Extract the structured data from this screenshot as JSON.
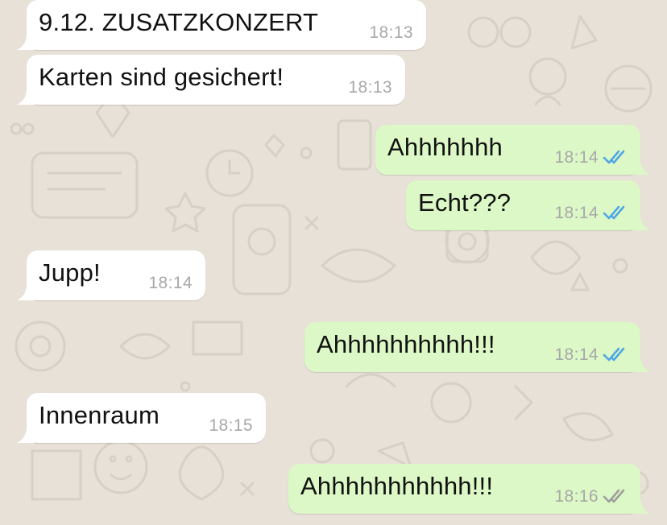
{
  "chat": {
    "messages": [
      {
        "direction": "in",
        "text": "9.12. ZUSATZKONZERT",
        "time": "18:13"
      },
      {
        "direction": "in",
        "text": "Karten sind gesichert!",
        "time": "18:13"
      },
      {
        "direction": "out",
        "text": "Ahhhhhhh",
        "time": "18:14",
        "status": "read"
      },
      {
        "direction": "out",
        "text": "Echt???",
        "time": "18:14",
        "status": "read"
      },
      {
        "direction": "in",
        "text": "Jupp!",
        "time": "18:14"
      },
      {
        "direction": "out",
        "text": "Ahhhhhhhhhh!!!",
        "time": "18:14",
        "status": "read"
      },
      {
        "direction": "in",
        "text": "Innenraum",
        "time": "18:15"
      },
      {
        "direction": "out",
        "text": "Ahhhhhhhhhhh!!!",
        "time": "18:16",
        "status": "delivered"
      }
    ]
  },
  "colors": {
    "wallpaper": "#e7e1d8",
    "incoming_bubble": "#ffffff",
    "outgoing_bubble": "#dcf8c6",
    "read_check": "#4fa6e6",
    "delivered_check": "#9e9e9e",
    "timestamp": "#a8a8a8"
  },
  "icons": {
    "read": "double-check-icon-blue",
    "delivered": "double-check-icon-gray"
  }
}
